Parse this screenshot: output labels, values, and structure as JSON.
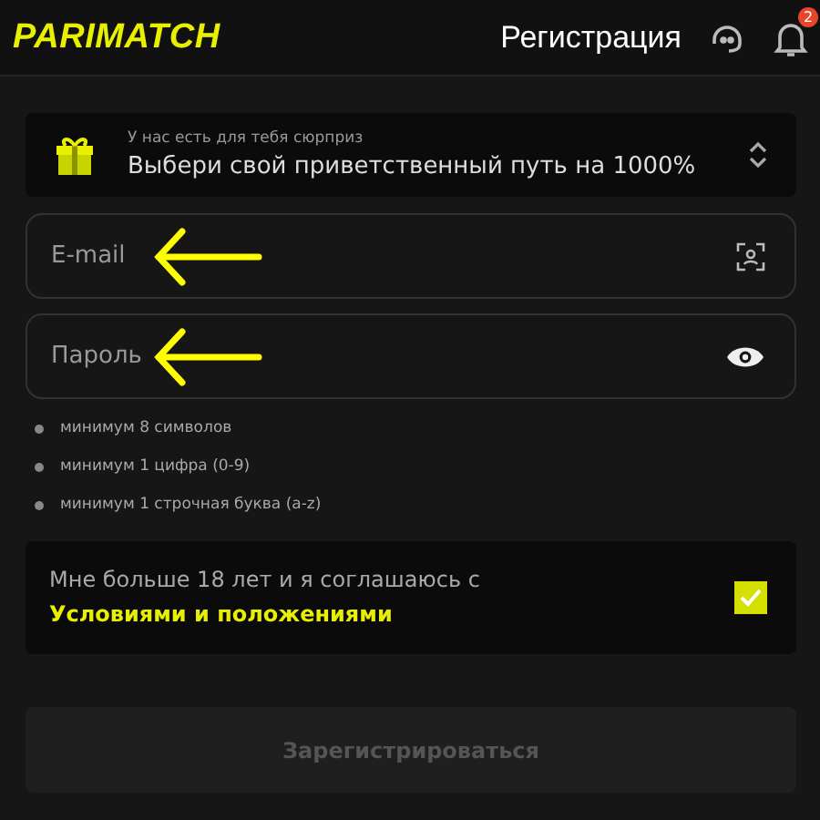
{
  "header": {
    "logo": "PARIMATCH",
    "title": "Регистрация",
    "notification_count": "2"
  },
  "promo": {
    "caption": "У нас есть для тебя сюрприз",
    "headline": "Выбери свой приветственный путь на 1000%"
  },
  "fields": [
    {
      "kind": "email",
      "placeholder": "E-mail",
      "arrow": true
    },
    {
      "kind": "password",
      "placeholder": "Пароль",
      "arrow": true
    }
  ],
  "password_rules": [
    "минимум 8 символов",
    "минимум 1 цифра (0-9)",
    "минимум 1 строчная буква (a-z)"
  ],
  "consent": {
    "text": "Мне больше 18 лет и я соглашаюсь с",
    "link": "Условиями и положениями",
    "checked": true
  },
  "submit": {
    "label": "Зарегистрироваться",
    "disabled": true
  }
}
